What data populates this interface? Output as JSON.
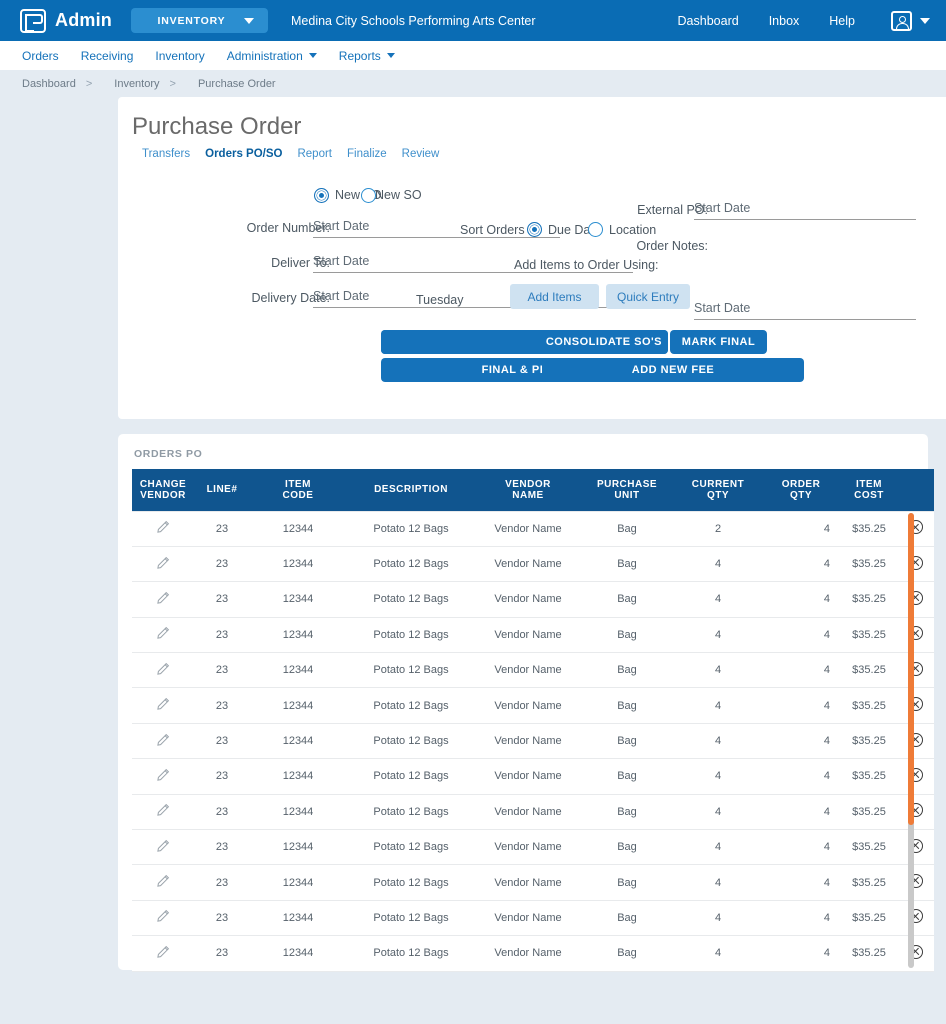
{
  "topbar": {
    "brand": "Admin",
    "module": "INVENTORY",
    "org": "Medina City Schools Performing Arts Center",
    "links": [
      "Dashboard",
      "Inbox",
      "Help"
    ],
    "bg_color": "#0a6cb4",
    "module_pill_color": "#2b8ed0"
  },
  "subnav": {
    "items": [
      {
        "label": "Orders",
        "has_caret": false
      },
      {
        "label": "Receiving",
        "has_caret": false
      },
      {
        "label": "Inventory",
        "has_caret": false
      },
      {
        "label": "Administration",
        "has_caret": true
      },
      {
        "label": "Reports",
        "has_caret": true
      }
    ],
    "link_color": "#1572ba"
  },
  "breadcrumb": [
    "Dashboard",
    "Inventory",
    "Purchase Order"
  ],
  "page": {
    "title": "Purchase Order",
    "tabs": [
      {
        "label": "Transfers",
        "active": false
      },
      {
        "label": "Orders PO/SO",
        "active": true
      },
      {
        "label": "Report",
        "active": false
      },
      {
        "label": "Finalize",
        "active": false
      },
      {
        "label": "Review",
        "active": false
      }
    ]
  },
  "form": {
    "order_type": {
      "new_po_label": "New PO",
      "new_so_label": "New SO",
      "selected": "New PO"
    },
    "order_number": {
      "label": "Order Number:",
      "value": "Start Date"
    },
    "deliver_to": {
      "label": "Deliver To:",
      "value": "Start Date"
    },
    "delivery_date": {
      "label": "Delivery Date:",
      "value": "Start Date",
      "day": "Tuesday"
    },
    "external_po": {
      "label": "External PO:",
      "value": "Start Date"
    },
    "order_notes": {
      "label": "Order Notes:",
      "value": "Start Date"
    },
    "sort_orders": {
      "label": "Sort Orders by",
      "options": [
        "Due Date",
        "Location"
      ],
      "selected": "Due Date"
    },
    "add_items_using": {
      "label": "Add Items to Order Using:",
      "buttons": [
        "Add Items",
        "Quick Entry"
      ]
    },
    "actions": [
      "ADD NEW FEE",
      "CONSOLIDATE SO'S",
      "MARK FINAL",
      "FINAL & PRINT",
      "ADD NEW FEE"
    ],
    "button_color": "#1572ba",
    "light_button_color": "#cfe2f1"
  },
  "table": {
    "title": "ORDERS PO",
    "header_color": "#10558f",
    "columns": [
      "CHANGE VENDOR",
      "LINE#",
      "ITEM CODE",
      "DESCRIPTION",
      "VENDOR NAME",
      "PURCHASE UNIT",
      "CURRENT QTY",
      "ORDER QTY",
      "ITEM COST",
      ""
    ],
    "columns_split": [
      [
        "CHANGE",
        "VENDOR"
      ],
      [
        "LINE#",
        ""
      ],
      [
        "ITEM",
        "CODE"
      ],
      [
        "DESCRIPTION",
        ""
      ],
      [
        "VENDOR",
        "NAME"
      ],
      [
        "PURCHASE",
        "UNIT"
      ],
      [
        "CURRENT",
        "QTY"
      ],
      [
        "ORDER",
        "QTY"
      ],
      [
        "ITEM",
        "COST"
      ],
      [
        "",
        ""
      ]
    ],
    "edit_icon": "pencil-icon",
    "delete_icon": "delete-circle-icon",
    "rows": [
      {
        "line": "23",
        "code": "12344",
        "description": "Potato 12 Bags",
        "vendor": "Vendor Name",
        "unit": "Bag",
        "current_qty": "2",
        "order_qty": "4",
        "cost": "$35.25"
      },
      {
        "line": "23",
        "code": "12344",
        "description": "Potato 12 Bags",
        "vendor": "Vendor Name",
        "unit": "Bag",
        "current_qty": "4",
        "order_qty": "4",
        "cost": "$35.25"
      },
      {
        "line": "23",
        "code": "12344",
        "description": "Potato 12 Bags",
        "vendor": "Vendor Name",
        "unit": "Bag",
        "current_qty": "4",
        "order_qty": "4",
        "cost": "$35.25"
      },
      {
        "line": "23",
        "code": "12344",
        "description": "Potato 12 Bags",
        "vendor": "Vendor Name",
        "unit": "Bag",
        "current_qty": "4",
        "order_qty": "4",
        "cost": "$35.25"
      },
      {
        "line": "23",
        "code": "12344",
        "description": "Potato 12 Bags",
        "vendor": "Vendor Name",
        "unit": "Bag",
        "current_qty": "4",
        "order_qty": "4",
        "cost": "$35.25"
      },
      {
        "line": "23",
        "code": "12344",
        "description": "Potato 12 Bags",
        "vendor": "Vendor Name",
        "unit": "Bag",
        "current_qty": "4",
        "order_qty": "4",
        "cost": "$35.25"
      },
      {
        "line": "23",
        "code": "12344",
        "description": "Potato 12 Bags",
        "vendor": "Vendor Name",
        "unit": "Bag",
        "current_qty": "4",
        "order_qty": "4",
        "cost": "$35.25"
      },
      {
        "line": "23",
        "code": "12344",
        "description": "Potato 12 Bags",
        "vendor": "Vendor Name",
        "unit": "Bag",
        "current_qty": "4",
        "order_qty": "4",
        "cost": "$35.25"
      },
      {
        "line": "23",
        "code": "12344",
        "description": "Potato 12 Bags",
        "vendor": "Vendor Name",
        "unit": "Bag",
        "current_qty": "4",
        "order_qty": "4",
        "cost": "$35.25"
      },
      {
        "line": "23",
        "code": "12344",
        "description": "Potato 12 Bags",
        "vendor": "Vendor Name",
        "unit": "Bag",
        "current_qty": "4",
        "order_qty": "4",
        "cost": "$35.25"
      },
      {
        "line": "23",
        "code": "12344",
        "description": "Potato 12 Bags",
        "vendor": "Vendor Name",
        "unit": "Bag",
        "current_qty": "4",
        "order_qty": "4",
        "cost": "$35.25"
      },
      {
        "line": "23",
        "code": "12344",
        "description": "Potato 12 Bags",
        "vendor": "Vendor Name",
        "unit": "Bag",
        "current_qty": "4",
        "order_qty": "4",
        "cost": "$35.25"
      },
      {
        "line": "23",
        "code": "12344",
        "description": "Potato 12 Bags",
        "vendor": "Vendor Name",
        "unit": "Bag",
        "current_qty": "4",
        "order_qty": "4",
        "cost": "$35.25"
      }
    ],
    "scrollbar": {
      "thumb_color": "#ef7b37",
      "track_color": "#c9c9c9"
    }
  }
}
